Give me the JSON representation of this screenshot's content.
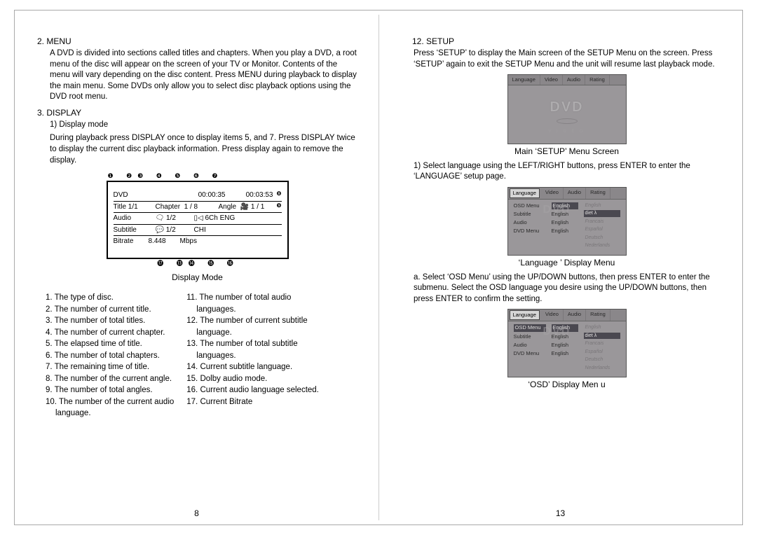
{
  "left": {
    "menu": {
      "heading": "2. MENU",
      "body": "A DVD is divided into sections called titles and chapters. When you play a DVD, a root menu of the disc will appear on the screen of your  TV or Monitor. Contents of the menu will vary depending on the disc  content. Press MENU during playback to display the main menu.  Some DVDs only allow you to select disc playback options using the DVD root menu."
    },
    "display": {
      "heading": "3. DISPLAY",
      "sub1_title": "1) Display mode",
      "sub1_body": "During playback press DISPLAY once to display items 5, and 7. Press DISPLAY twice to display the current disc playback information. Press display again to remove the display.",
      "diagram": {
        "row1_a": "DVD",
        "row1_b": "00:00:35",
        "row1_c": "00:03:53",
        "row2_a": "Title 1/1",
        "row2_b": "Chapter  1 / 8",
        "row2_c": "Angle  🎥 1 / 1",
        "row3_a": "Audio",
        "row3_b": "🗨 1/2",
        "row3_c": "▯◁ 6Ch ENG",
        "row4_a": "Subtitle",
        "row4_b": "💬 1/2",
        "row4_c": "CHI",
        "row5_a": "Bitrate",
        "row5_b": "8.448",
        "row5_c": "Mbps",
        "caption": "Display Mode"
      },
      "legend_left": [
        "1. The type of disc.",
        "2. The number of current title.",
        "3. The number of total titles.",
        "4. The number of current chapter.",
        "5. The elapsed time of title.",
        "6. The number of total chapters.",
        "7. The remaining time of title.",
        "8. The number of the current angle.",
        "9. The number of total angles.",
        "10. The number of the current audio",
        "language."
      ],
      "legend_right": [
        "11. The number of total audio",
        "languages.",
        "12. The number of current subtitle",
        "language.",
        "13. The number of total subtitle",
        "languages.",
        "14. Current subtitle language.",
        "15. Dolby audio mode.",
        "16. Current audio language selected.",
        "17. Current Bitrate"
      ]
    },
    "pagenum": "8"
  },
  "right": {
    "setup": {
      "heading": "12. SETUP",
      "body1": "Press ‘SETUP’ to display the Main screen of the SETUP Menu on the screen. Press  ‘SETUP’  again to exit  the SETUP Menu and the  unit will resume last playback mode.",
      "main_tabs": [
        "Language",
        "Video",
        "Audio",
        "Rating"
      ],
      "dvd_logo": "DVD",
      "dvd_sub": "V  I  D  E  O",
      "caption1": "Main  ‘SETUP’  Menu Screen",
      "step1": "1) Select language using the LEFT/RIGHT buttons, press ENTER to enter the  ‘LANGUAGE’  setup page.",
      "lang_menu": {
        "col1": [
          "OSD Menu",
          "Subtitle",
          "Audio",
          "DVD Menu"
        ],
        "col2": [
          "English",
          "English",
          "English",
          "English"
        ],
        "col3": [
          "English",
          "",
          "Francais",
          "Español",
          "Deutsch",
          "Nederlands"
        ],
        "col3_sel": "diet λ"
      },
      "caption2": "‘Language ’  Display Menu",
      "step_a": "a. Select  ‘OSD  Menu’  using the UP/DOWN buttons, then press ENTER to enter the submenu. Select the  OSD  language you desire using the UP/DOWN buttons, then press ENTER to confirm the setting.",
      "caption3": "‘OSD’   Display Men  u"
    },
    "pagenum": "13"
  }
}
